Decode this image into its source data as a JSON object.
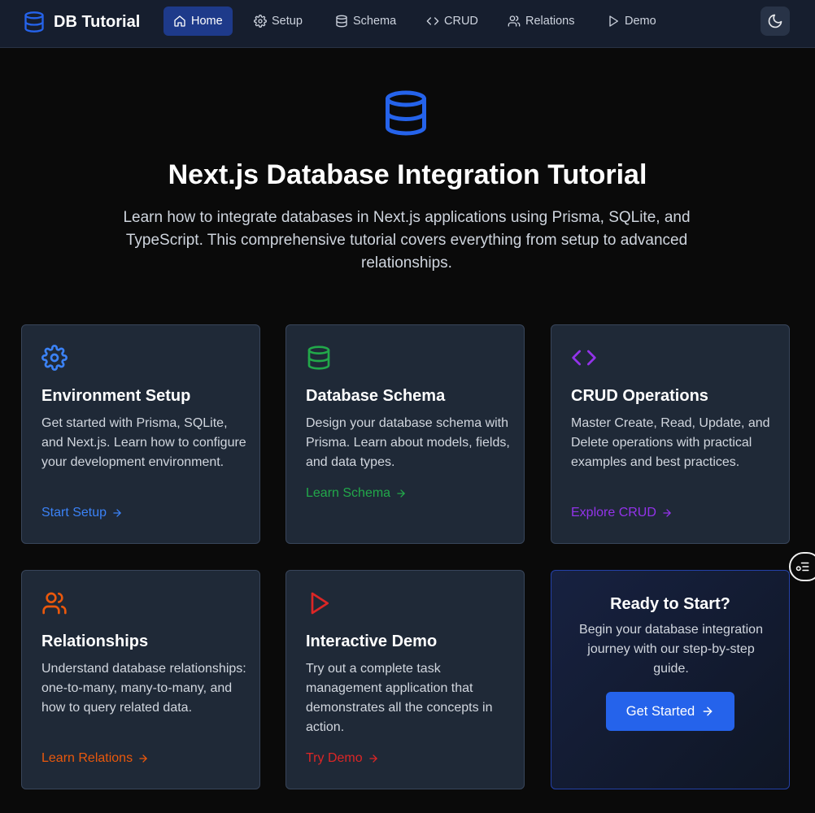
{
  "app": {
    "brand": "DB Tutorial"
  },
  "nav": [
    {
      "label": "Home",
      "icon": "home-icon",
      "active": true
    },
    {
      "label": "Setup",
      "icon": "gear-icon",
      "active": false
    },
    {
      "label": "Schema",
      "icon": "database-icon",
      "active": false
    },
    {
      "label": "CRUD",
      "icon": "code-icon",
      "active": false
    },
    {
      "label": "Relations",
      "icon": "users-icon",
      "active": false
    },
    {
      "label": "Demo",
      "icon": "play-icon",
      "active": false
    }
  ],
  "theme_toggle": {
    "icon": "moon-icon"
  },
  "hero": {
    "icon": "database-icon",
    "title": "Next.js Database Integration Tutorial",
    "subtitle": "Learn how to integrate databases in Next.js applications using Prisma, SQLite, and TypeScript. This comprehensive tutorial covers everything from setup to advanced relationships."
  },
  "cards": [
    {
      "title": "Environment Setup",
      "description": "Get started with Prisma, SQLite, and Next.js. Learn how to configure your development environment.",
      "link": "Start Setup",
      "icon": "gear-icon",
      "color": "#3b82f6"
    },
    {
      "title": "Database Schema",
      "description": "Design your database schema with Prisma. Learn about models, fields, and data types.",
      "link": "Learn Schema",
      "icon": "database-icon",
      "color": "#22a84a"
    },
    {
      "title": "CRUD Operations",
      "description": "Master Create, Read, Update, and Delete operations with practical examples and best practices.",
      "link": "Explore CRUD",
      "icon": "code-icon",
      "color": "#9333ea"
    },
    {
      "title": "Relationships",
      "description": "Understand database relationships: one-to-many, many-to-many, and how to query related data.",
      "link": "Learn Relations",
      "icon": "users-icon",
      "color": "#ea580c"
    },
    {
      "title": "Interactive Demo",
      "description": "Try out a complete task management application that demonstrates all the concepts in action.",
      "link": "Try Demo",
      "icon": "play-icon",
      "color": "#dc2626"
    }
  ],
  "cta": {
    "title": "Ready to Start?",
    "description": "Begin your database integration journey with our step-by-step guide.",
    "button": "Get Started"
  },
  "colors": {
    "accent": "#2563eb",
    "nav_active_bg": "#1e3a8a",
    "card_bg": "#1f2937"
  }
}
